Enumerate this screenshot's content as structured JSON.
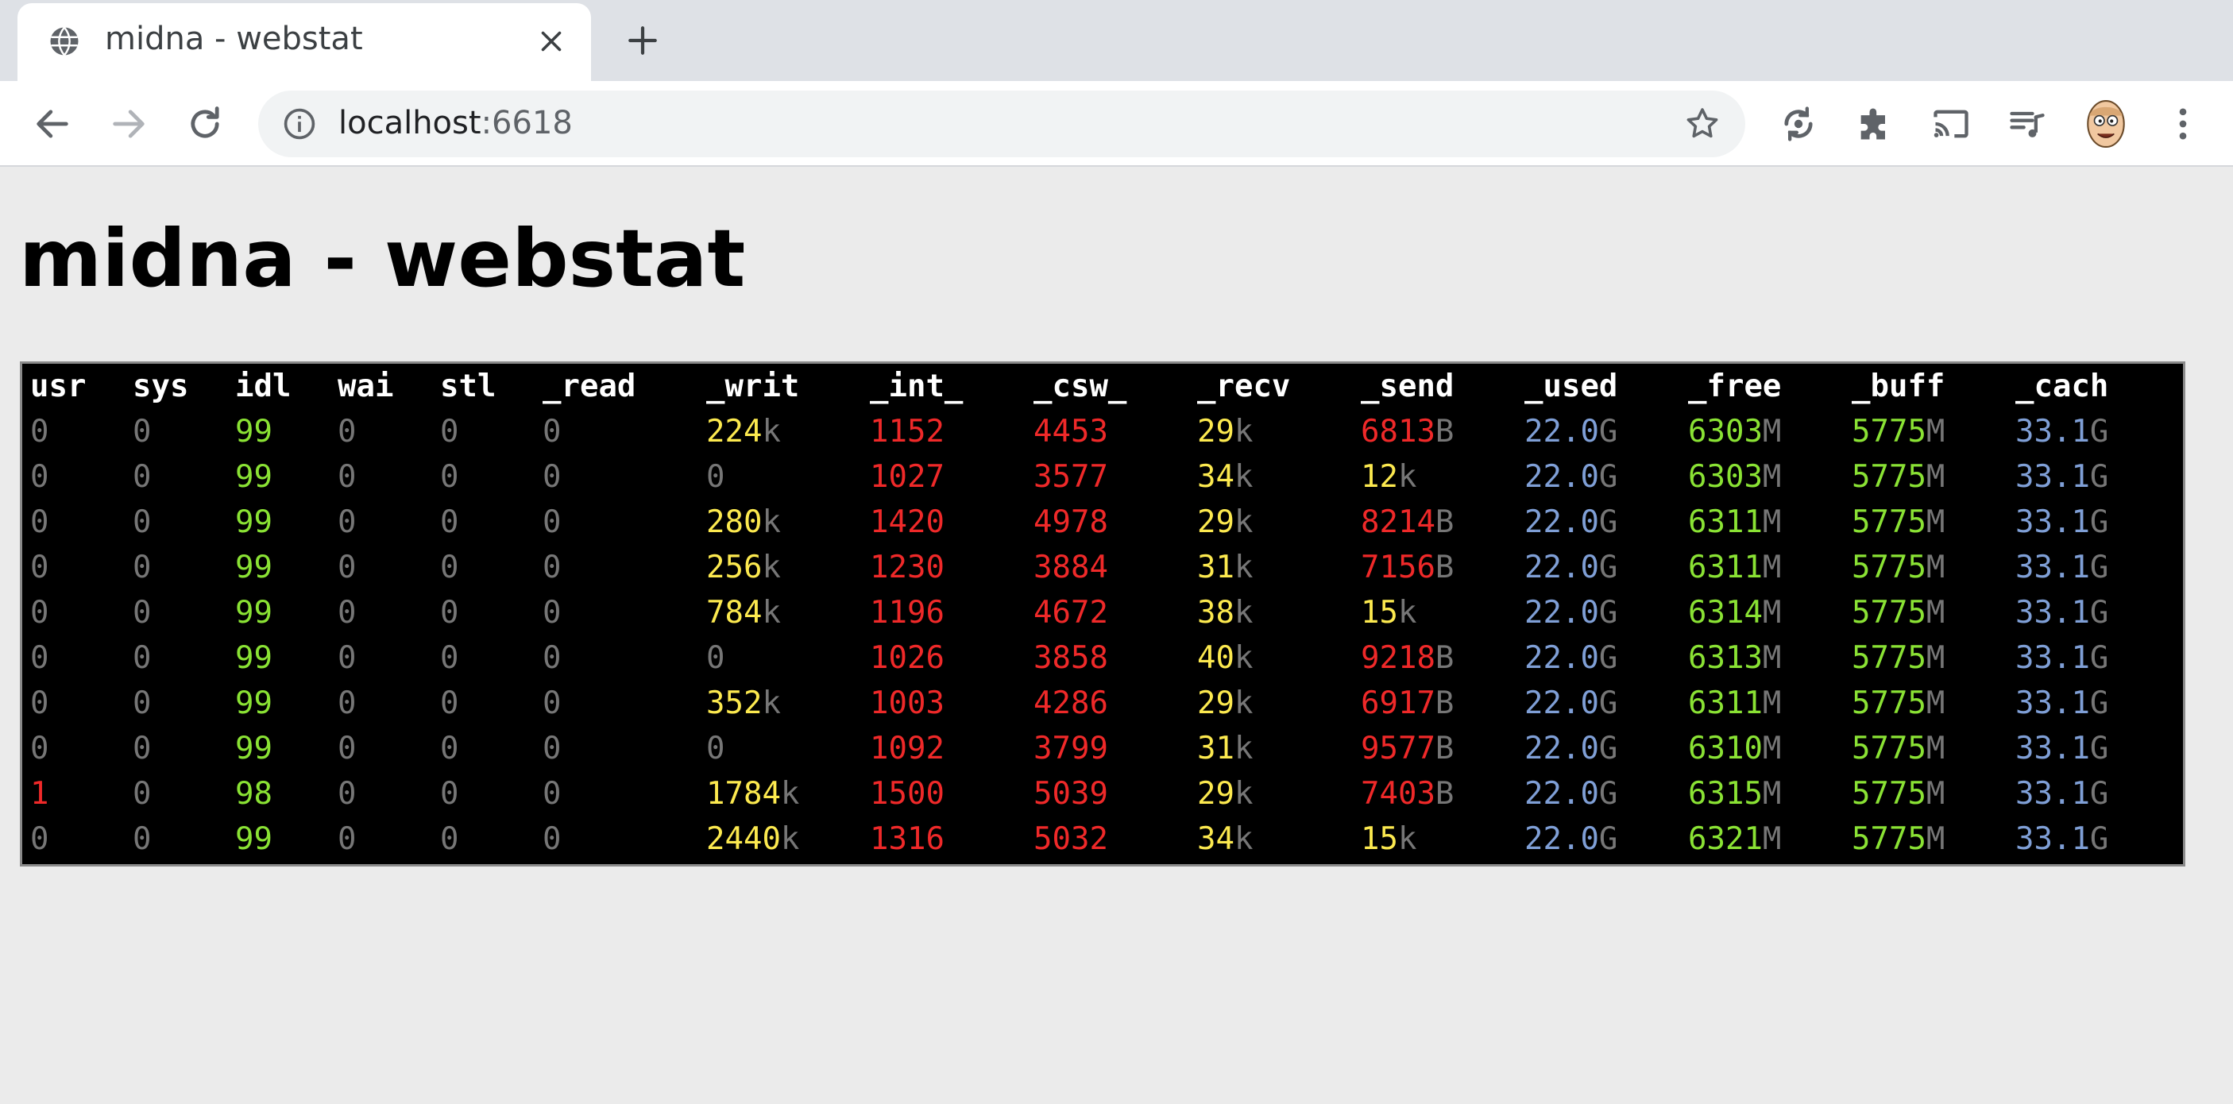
{
  "browser": {
    "tab_title": "midna - webstat",
    "url_host": "localhost",
    "url_port": ":6618"
  },
  "page": {
    "title": "midna - webstat"
  },
  "colors": {
    "grey": "#767676",
    "green": "#8ae234",
    "red": "#ef2929",
    "yellow": "#fce94f",
    "blue": "#7f9fd6"
  },
  "columns": [
    "usr",
    "sys",
    "idl",
    "wai",
    "stl",
    "_read",
    "_writ",
    "_int_",
    "_csw_",
    "_recv",
    "_send",
    "_used",
    "_free",
    "_buff",
    "_cach"
  ],
  "rows": [
    [
      [
        "0",
        "",
        "grey"
      ],
      [
        "0",
        "",
        "grey"
      ],
      [
        "99",
        "",
        "green"
      ],
      [
        "0",
        "",
        "grey"
      ],
      [
        "0",
        "",
        "grey"
      ],
      [
        "0",
        "",
        "grey"
      ],
      [
        "224",
        "k",
        "yellow"
      ],
      [
        "1152",
        "",
        "red"
      ],
      [
        "4453",
        "",
        "red"
      ],
      [
        "29",
        "k",
        "yellow"
      ],
      [
        "6813",
        "B",
        "red"
      ],
      [
        "22.0",
        "G",
        "blue"
      ],
      [
        "6303",
        "M",
        "green"
      ],
      [
        "5775",
        "M",
        "green"
      ],
      [
        "33.1",
        "G",
        "blue"
      ]
    ],
    [
      [
        "0",
        "",
        "grey"
      ],
      [
        "0",
        "",
        "grey"
      ],
      [
        "99",
        "",
        "green"
      ],
      [
        "0",
        "",
        "grey"
      ],
      [
        "0",
        "",
        "grey"
      ],
      [
        "0",
        "",
        "grey"
      ],
      [
        "0",
        "",
        "grey"
      ],
      [
        "1027",
        "",
        "red"
      ],
      [
        "3577",
        "",
        "red"
      ],
      [
        "34",
        "k",
        "yellow"
      ],
      [
        "12",
        "k",
        "yellow"
      ],
      [
        "22.0",
        "G",
        "blue"
      ],
      [
        "6303",
        "M",
        "green"
      ],
      [
        "5775",
        "M",
        "green"
      ],
      [
        "33.1",
        "G",
        "blue"
      ]
    ],
    [
      [
        "0",
        "",
        "grey"
      ],
      [
        "0",
        "",
        "grey"
      ],
      [
        "99",
        "",
        "green"
      ],
      [
        "0",
        "",
        "grey"
      ],
      [
        "0",
        "",
        "grey"
      ],
      [
        "0",
        "",
        "grey"
      ],
      [
        "280",
        "k",
        "yellow"
      ],
      [
        "1420",
        "",
        "red"
      ],
      [
        "4978",
        "",
        "red"
      ],
      [
        "29",
        "k",
        "yellow"
      ],
      [
        "8214",
        "B",
        "red"
      ],
      [
        "22.0",
        "G",
        "blue"
      ],
      [
        "6311",
        "M",
        "green"
      ],
      [
        "5775",
        "M",
        "green"
      ],
      [
        "33.1",
        "G",
        "blue"
      ]
    ],
    [
      [
        "0",
        "",
        "grey"
      ],
      [
        "0",
        "",
        "grey"
      ],
      [
        "99",
        "",
        "green"
      ],
      [
        "0",
        "",
        "grey"
      ],
      [
        "0",
        "",
        "grey"
      ],
      [
        "0",
        "",
        "grey"
      ],
      [
        "256",
        "k",
        "yellow"
      ],
      [
        "1230",
        "",
        "red"
      ],
      [
        "3884",
        "",
        "red"
      ],
      [
        "31",
        "k",
        "yellow"
      ],
      [
        "7156",
        "B",
        "red"
      ],
      [
        "22.0",
        "G",
        "blue"
      ],
      [
        "6311",
        "M",
        "green"
      ],
      [
        "5775",
        "M",
        "green"
      ],
      [
        "33.1",
        "G",
        "blue"
      ]
    ],
    [
      [
        "0",
        "",
        "grey"
      ],
      [
        "0",
        "",
        "grey"
      ],
      [
        "99",
        "",
        "green"
      ],
      [
        "0",
        "",
        "grey"
      ],
      [
        "0",
        "",
        "grey"
      ],
      [
        "0",
        "",
        "grey"
      ],
      [
        "784",
        "k",
        "yellow"
      ],
      [
        "1196",
        "",
        "red"
      ],
      [
        "4672",
        "",
        "red"
      ],
      [
        "38",
        "k",
        "yellow"
      ],
      [
        "15",
        "k",
        "yellow"
      ],
      [
        "22.0",
        "G",
        "blue"
      ],
      [
        "6314",
        "M",
        "green"
      ],
      [
        "5775",
        "M",
        "green"
      ],
      [
        "33.1",
        "G",
        "blue"
      ]
    ],
    [
      [
        "0",
        "",
        "grey"
      ],
      [
        "0",
        "",
        "grey"
      ],
      [
        "99",
        "",
        "green"
      ],
      [
        "0",
        "",
        "grey"
      ],
      [
        "0",
        "",
        "grey"
      ],
      [
        "0",
        "",
        "grey"
      ],
      [
        "0",
        "",
        "grey"
      ],
      [
        "1026",
        "",
        "red"
      ],
      [
        "3858",
        "",
        "red"
      ],
      [
        "40",
        "k",
        "yellow"
      ],
      [
        "9218",
        "B",
        "red"
      ],
      [
        "22.0",
        "G",
        "blue"
      ],
      [
        "6313",
        "M",
        "green"
      ],
      [
        "5775",
        "M",
        "green"
      ],
      [
        "33.1",
        "G",
        "blue"
      ]
    ],
    [
      [
        "0",
        "",
        "grey"
      ],
      [
        "0",
        "",
        "grey"
      ],
      [
        "99",
        "",
        "green"
      ],
      [
        "0",
        "",
        "grey"
      ],
      [
        "0",
        "",
        "grey"
      ],
      [
        "0",
        "",
        "grey"
      ],
      [
        "352",
        "k",
        "yellow"
      ],
      [
        "1003",
        "",
        "red"
      ],
      [
        "4286",
        "",
        "red"
      ],
      [
        "29",
        "k",
        "yellow"
      ],
      [
        "6917",
        "B",
        "red"
      ],
      [
        "22.0",
        "G",
        "blue"
      ],
      [
        "6311",
        "M",
        "green"
      ],
      [
        "5775",
        "M",
        "green"
      ],
      [
        "33.1",
        "G",
        "blue"
      ]
    ],
    [
      [
        "0",
        "",
        "grey"
      ],
      [
        "0",
        "",
        "grey"
      ],
      [
        "99",
        "",
        "green"
      ],
      [
        "0",
        "",
        "grey"
      ],
      [
        "0",
        "",
        "grey"
      ],
      [
        "0",
        "",
        "grey"
      ],
      [
        "0",
        "",
        "grey"
      ],
      [
        "1092",
        "",
        "red"
      ],
      [
        "3799",
        "",
        "red"
      ],
      [
        "31",
        "k",
        "yellow"
      ],
      [
        "9577",
        "B",
        "red"
      ],
      [
        "22.0",
        "G",
        "blue"
      ],
      [
        "6310",
        "M",
        "green"
      ],
      [
        "5775",
        "M",
        "green"
      ],
      [
        "33.1",
        "G",
        "blue"
      ]
    ],
    [
      [
        "1",
        "",
        "red"
      ],
      [
        "0",
        "",
        "grey"
      ],
      [
        "98",
        "",
        "green"
      ],
      [
        "0",
        "",
        "grey"
      ],
      [
        "0",
        "",
        "grey"
      ],
      [
        "0",
        "",
        "grey"
      ],
      [
        "1784",
        "k",
        "yellow"
      ],
      [
        "1500",
        "",
        "red"
      ],
      [
        "5039",
        "",
        "red"
      ],
      [
        "29",
        "k",
        "yellow"
      ],
      [
        "7403",
        "B",
        "red"
      ],
      [
        "22.0",
        "G",
        "blue"
      ],
      [
        "6315",
        "M",
        "green"
      ],
      [
        "5775",
        "M",
        "green"
      ],
      [
        "33.1",
        "G",
        "blue"
      ]
    ],
    [
      [
        "0",
        "",
        "grey"
      ],
      [
        "0",
        "",
        "grey"
      ],
      [
        "99",
        "",
        "green"
      ],
      [
        "0",
        "",
        "grey"
      ],
      [
        "0",
        "",
        "grey"
      ],
      [
        "0",
        "",
        "grey"
      ],
      [
        "2440",
        "k",
        "yellow"
      ],
      [
        "1316",
        "",
        "red"
      ],
      [
        "5032",
        "",
        "red"
      ],
      [
        "34",
        "k",
        "yellow"
      ],
      [
        "15",
        "k",
        "yellow"
      ],
      [
        "22.0",
        "G",
        "blue"
      ],
      [
        "6321",
        "M",
        "green"
      ],
      [
        "5775",
        "M",
        "green"
      ],
      [
        "33.1",
        "G",
        "blue"
      ]
    ]
  ]
}
